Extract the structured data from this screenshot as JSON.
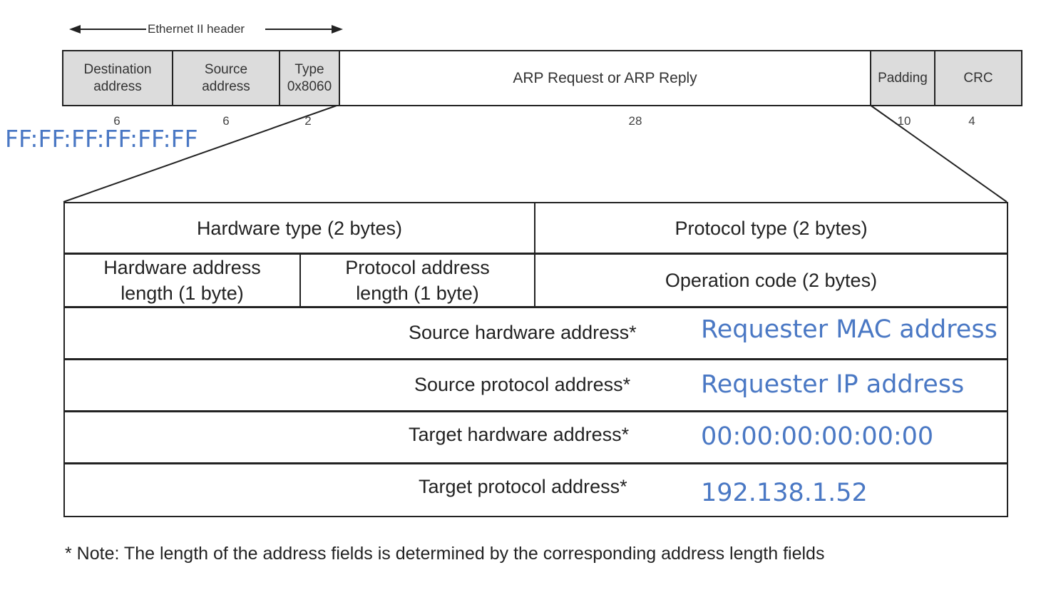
{
  "ethernet_header_label": "Ethernet II header",
  "frame": {
    "fields": [
      {
        "label": "Destination\naddress",
        "size": "6"
      },
      {
        "label": "Source\naddress",
        "size": "6"
      },
      {
        "label": "Type\n0x8060",
        "size": "2"
      },
      {
        "label": "ARP Request or ARP Reply",
        "size": "28"
      },
      {
        "label": "Padding",
        "size": "10"
      },
      {
        "label": "CRC",
        "size": "4"
      }
    ],
    "broadcast_mac": "FF:FF:FF:FF:FF:FF"
  },
  "arp": {
    "hardware_type": "Hardware type (2 bytes)",
    "protocol_type": "Protocol type (2 bytes)",
    "hw_addr_len": "Hardware address\nlength (1 byte)",
    "proto_addr_len": "Protocol address\nlength (1 byte)",
    "operation_code": "Operation code (2 bytes)",
    "rows": [
      {
        "label": "Source hardware address*",
        "value": "Requester MAC address"
      },
      {
        "label": "Source protocol address*",
        "value": "Requester IP address"
      },
      {
        "label": "Target hardware  address*",
        "value": "00:00:00:00:00:00"
      },
      {
        "label": "Target protocol address*",
        "value": "192.138.1.52"
      }
    ]
  },
  "note": "* Note: The length of the address fields is determined by the corresponding address length fields",
  "colors": {
    "annotation": "#4a78c4",
    "field_fill": "#dcdcdc",
    "line": "#222222"
  }
}
